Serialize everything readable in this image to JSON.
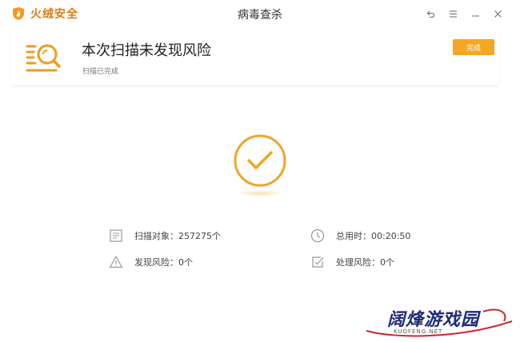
{
  "app": {
    "brand_name": "火绒安全",
    "window_title": "病毒查杀"
  },
  "window_controls": [
    "back-icon",
    "menu-icon",
    "minimize-icon",
    "close-icon"
  ],
  "result": {
    "title": "本次扫描未发现风险",
    "subtitle": "扫描已完成",
    "done_button": "完成"
  },
  "stats": {
    "scanned_objects": "扫描对象：257275个",
    "time_used": "总用时：00:20:50",
    "risks_found": "发现风险：0个",
    "risks_handled": "处理风险：0个"
  },
  "watermark": {
    "text": "阔烽游戏园",
    "url": "KUOFENG.NET"
  },
  "colors": {
    "accent": "#f7a622",
    "brand": "#e07a12",
    "watermark": "#1d2b7a"
  }
}
